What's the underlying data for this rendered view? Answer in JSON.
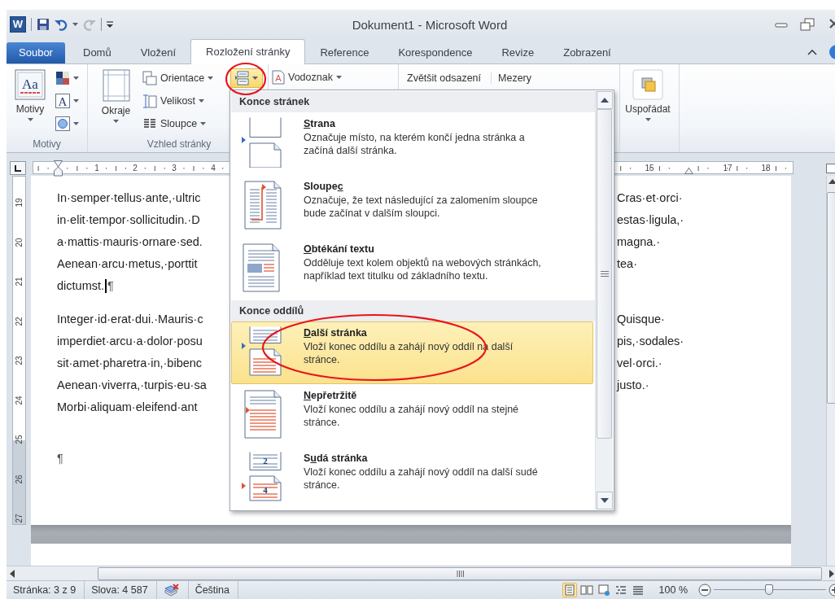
{
  "quick_access": [
    {
      "kind": "app",
      "label": "W",
      "disabled": false
    },
    {
      "kind": "save",
      "disabled": false
    },
    {
      "kind": "undo",
      "disabled": false
    },
    {
      "kind": "redo",
      "disabled": true
    },
    {
      "kind": "customize",
      "disabled": false
    }
  ],
  "window": {
    "title": "Dokument1 - Microsoft Word"
  },
  "tabs": [
    {
      "label": "Soubor",
      "kind": "file",
      "selected": false
    },
    {
      "label": "Domů",
      "kind": "tab",
      "selected": false
    },
    {
      "label": "Vložení",
      "kind": "tab",
      "selected": false
    },
    {
      "label": "Rozložení stránky",
      "kind": "tab",
      "selected": true
    },
    {
      "label": "Reference",
      "kind": "tab",
      "selected": false
    },
    {
      "label": "Korespondence",
      "kind": "tab",
      "selected": false
    },
    {
      "label": "Revize",
      "kind": "tab",
      "selected": false
    },
    {
      "label": "Zobrazení",
      "kind": "tab",
      "selected": false
    }
  ],
  "ribbon": {
    "themes_icon_text": "Aa",
    "themes_button": "Motivy",
    "fonts_icon_text": "A",
    "themes_group": "Motivy",
    "margins": "Okraje",
    "orientation": "Orientace",
    "size": "Velikost",
    "columns": "Sloupce",
    "breaks_pressed": true,
    "page_setup_group": "Vzhled stránky",
    "watermark_icon_text": "A",
    "watermark": "Vodoznak",
    "indent": "Zvětšit odsazení",
    "spacing": "Mezery",
    "arrange": "Uspořádat"
  },
  "breaks_menu": {
    "sections": [
      {
        "header": "Konce stránek",
        "items": [
          {
            "kind": "page",
            "access_key": "S",
            "title_end": "trana",
            "description": "Označuje místo, na kterém končí jedna stránka a\nzačíná další stránka.",
            "selected": false
          },
          {
            "kind": "column",
            "title_start": "Sloupe",
            "access_key": "c",
            "description": "Označuje, že text následující za zalomením sloupce\nbude začínat v dalším sloupci.",
            "selected": false
          },
          {
            "kind": "wrap",
            "access_key": "O",
            "title_end": "btékání textu",
            "description": "Odděluje text kolem objektů na webových stránkách,\nnapříklad text titulku od základního textu.",
            "selected": false
          }
        ]
      },
      {
        "header": "Konce oddílů",
        "items": [
          {
            "kind": "next",
            "access_key": "D",
            "title_end": "alší stránka",
            "description": "Vloží konec oddílu a zahájí nový oddíl na další\nstránce.",
            "selected": true
          },
          {
            "kind": "continuous",
            "access_key": "N",
            "title_end": "epřetržitě",
            "description": "Vloží konec oddílu a zahájí nový oddíl na stejné\nstránce.",
            "selected": false
          },
          {
            "kind": "even",
            "icon_text": [
              "2",
              "4"
            ],
            "title_start": "S",
            "access_key": "u",
            "title_end": "dá stránka",
            "description": "Vloží konec oddílu a zahájí nový oddíl na další sudé\nstránce.",
            "selected": false
          }
        ]
      }
    ]
  },
  "ruler": {
    "left_numbers": [
      "1",
      "2",
      "3",
      "4"
    ],
    "right_numbers": [
      "15",
      "17",
      "18"
    ]
  },
  "vertical_ruler": [
    "19",
    "20",
    "21",
    "22",
    "23",
    "24",
    "25",
    "26",
    "27"
  ],
  "document": {
    "paragraphs": [
      {
        "lines": [
          {
            "left": "In·semper·tellus·ante,·ultric",
            "right": "Cras·et·orci·"
          },
          {
            "left": "in·elit·tempor·sollicitudin.·D",
            "right": "estas·ligula,·"
          },
          {
            "left": "a·mattis·mauris·ornare·sed.",
            "right": "magna.·"
          },
          {
            "left": "Aenean·arcu·metus,·porttit",
            "right": "tea·"
          },
          {
            "left": "dictumst.",
            "cursor": true,
            "end_mark": "¶"
          }
        ]
      },
      {
        "lines": [
          {
            "left": "Integer·id·erat·dui.·Mauris·c",
            "right": "Quisque·"
          },
          {
            "left": "imperdiet·arcu·a·dolor·posu",
            "right": "pis,·sodales·"
          },
          {
            "left": "sit·amet·pharetra·in,·bibenc",
            "right": "vel·orci.·"
          },
          {
            "left": "Aenean·viverra,·turpis·eu·sa",
            "right": "justo.·"
          },
          {
            "left": "Morbi·aliquam·eleifend·ant"
          }
        ]
      },
      {
        "lines": [
          {
            "end_mark": "¶"
          }
        ]
      }
    ]
  },
  "status_bar": {
    "page": "Stránka: 3 z 9",
    "words": "Slova: 4 587",
    "language": "Čeština",
    "views": [
      {
        "kind": "print",
        "selected": true
      },
      {
        "kind": "reading",
        "selected": false
      },
      {
        "kind": "web",
        "selected": false
      },
      {
        "kind": "outline",
        "selected": false
      },
      {
        "kind": "draft",
        "selected": false
      }
    ],
    "zoom": "100 %",
    "zoom_slider": {
      "level": 0.49
    }
  }
}
